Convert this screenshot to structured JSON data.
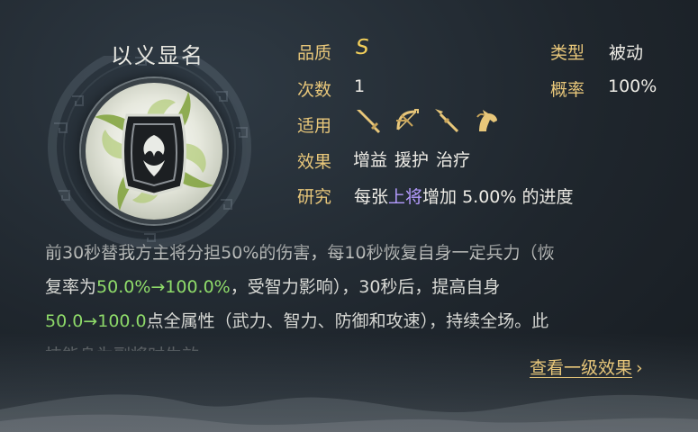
{
  "skill": {
    "name": "以义显名",
    "icon": "shield-medallion-icon"
  },
  "info": {
    "quality_label": "品质",
    "quality_value": "S",
    "type_label": "类型",
    "type_value": "被动",
    "uses_label": "次数",
    "uses_value": "1",
    "rate_label": "概率",
    "rate_value": "100%",
    "applicable_label": "适用",
    "applicable_icons": [
      "sword-icon",
      "bow-icon",
      "spear-icon",
      "horse-icon"
    ],
    "effect_label": "效果",
    "effect_tags": [
      "增益",
      "援护",
      "治疗"
    ],
    "research_label": "研究",
    "research_prefix": "每张",
    "research_highlight": "上将",
    "research_suffix": "增加 5.00% 的进度"
  },
  "description": {
    "line1": "前30秒替我方主将分担50%的伤害，每10秒恢复自身一定兵力（恢",
    "line2_a": "复率为",
    "line2_green": "50.0%→100.0%",
    "line2_b": "，受智力影响），30秒后，提高自身",
    "line3_green": "50.0→100.0",
    "line3_b": "点全属性（武力、智力、防御和攻速），持续全场。此",
    "line4": "技能身为副将时生效。"
  },
  "footer": {
    "more_label": "查看一级效果",
    "chevron": "›"
  },
  "colors": {
    "gold": "#e8c77a",
    "green": "#8fdc6a",
    "purple": "#b59cff"
  }
}
